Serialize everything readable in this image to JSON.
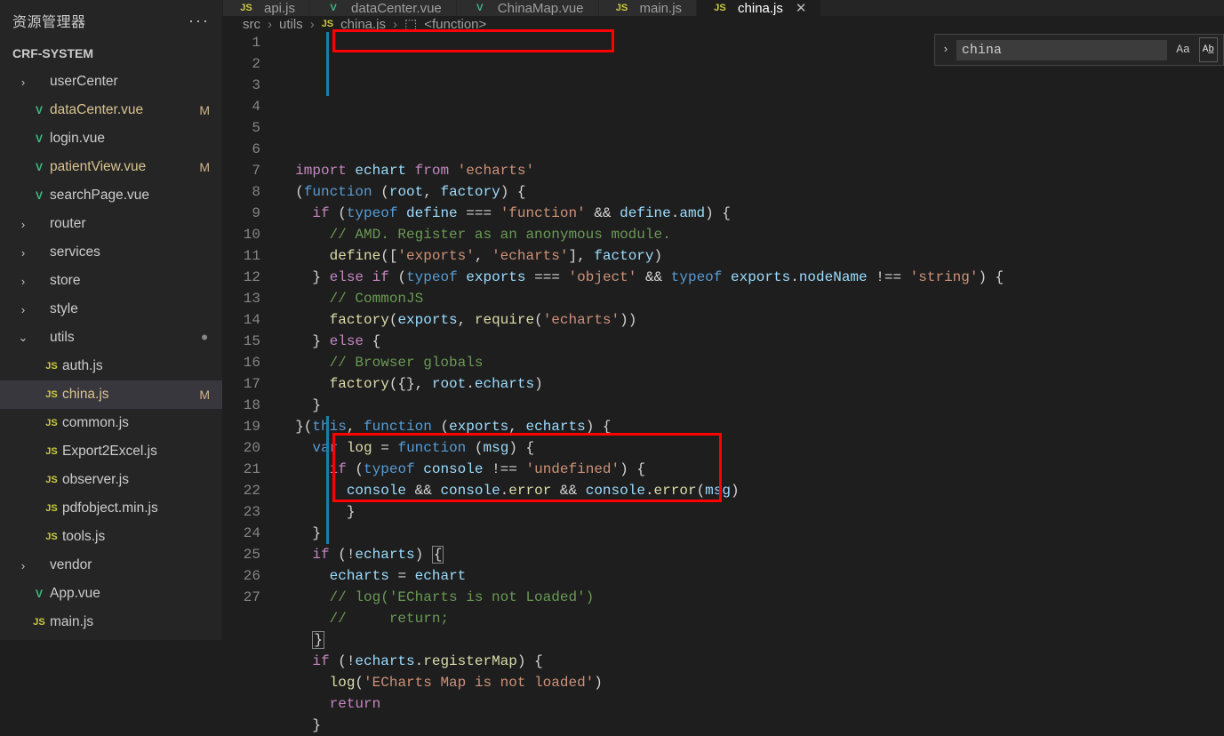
{
  "sidebar": {
    "title": "资源管理器",
    "project": "CRF-SYSTEM",
    "items": [
      {
        "chev": "›",
        "icon": "",
        "label": "userCenter",
        "badge": "",
        "kind": "folder"
      },
      {
        "chev": "",
        "icon": "V",
        "label": "dataCenter.vue",
        "badge": "M",
        "kind": "vue",
        "mod": true
      },
      {
        "chev": "",
        "icon": "V",
        "label": "login.vue",
        "badge": "",
        "kind": "vue"
      },
      {
        "chev": "",
        "icon": "V",
        "label": "patientView.vue",
        "badge": "M",
        "kind": "vue",
        "mod": true
      },
      {
        "chev": "",
        "icon": "V",
        "label": "searchPage.vue",
        "badge": "",
        "kind": "vue"
      },
      {
        "chev": "›",
        "icon": "",
        "label": "router",
        "badge": "",
        "kind": "folder"
      },
      {
        "chev": "›",
        "icon": "",
        "label": "services",
        "badge": "",
        "kind": "folder"
      },
      {
        "chev": "›",
        "icon": "",
        "label": "store",
        "badge": "",
        "kind": "folder"
      },
      {
        "chev": "›",
        "icon": "",
        "label": "style",
        "badge": "",
        "kind": "folder"
      },
      {
        "chev": "⌄",
        "icon": "",
        "label": "utils",
        "badge": "•",
        "kind": "folder-open"
      },
      {
        "chev": "",
        "icon": "JS",
        "label": "auth.js",
        "badge": "",
        "kind": "js",
        "nest": true
      },
      {
        "chev": "",
        "icon": "JS",
        "label": "china.js",
        "badge": "M",
        "kind": "js",
        "nest": true,
        "sel": true,
        "mod": true
      },
      {
        "chev": "",
        "icon": "JS",
        "label": "common.js",
        "badge": "",
        "kind": "js",
        "nest": true
      },
      {
        "chev": "",
        "icon": "JS",
        "label": "Export2Excel.js",
        "badge": "",
        "kind": "js",
        "nest": true
      },
      {
        "chev": "",
        "icon": "JS",
        "label": "observer.js",
        "badge": "",
        "kind": "js",
        "nest": true
      },
      {
        "chev": "",
        "icon": "JS",
        "label": "pdfobject.min.js",
        "badge": "",
        "kind": "js",
        "nest": true
      },
      {
        "chev": "",
        "icon": "JS",
        "label": "tools.js",
        "badge": "",
        "kind": "js",
        "nest": true
      },
      {
        "chev": "›",
        "icon": "",
        "label": "vendor",
        "badge": "",
        "kind": "folder"
      },
      {
        "chev": "",
        "icon": "V",
        "label": "App.vue",
        "badge": "",
        "kind": "vue"
      },
      {
        "chev": "",
        "icon": "JS",
        "label": "main.js",
        "badge": "",
        "kind": "js"
      }
    ]
  },
  "tabs": [
    {
      "icon": "JS",
      "kind": "js",
      "label": "api.js"
    },
    {
      "icon": "V",
      "kind": "vue",
      "label": "dataCenter.vue"
    },
    {
      "icon": "V",
      "kind": "vue",
      "label": "ChinaMap.vue"
    },
    {
      "icon": "JS",
      "kind": "js",
      "label": "main.js"
    },
    {
      "icon": "JS",
      "kind": "js",
      "label": "china.js",
      "active": true,
      "close": true
    }
  ],
  "breadcrumbs": [
    "src",
    "utils",
    "china.js",
    "<function>"
  ],
  "search": {
    "value": "china",
    "aa": "Aa",
    "ab": "Ab̲"
  },
  "code": {
    "start": 1,
    "lines": [
      "  <span class='c-pink'>import</span> <span class='c-lblue'>echart</span> <span class='c-pink'>from</span> <span class='c-str'>'echarts'</span>",
      "  <span class='c-punc'>(</span><span class='c-blue'>function</span> <span class='c-punc'>(</span><span class='c-lblue'>root</span><span class='c-punc'>,</span> <span class='c-lblue'>factory</span><span class='c-punc'>) {</span>",
      "    <span class='c-pink'>if</span> <span class='c-punc'>(</span><span class='c-blue'>typeof</span> <span class='c-lblue'>define</span> <span class='c-punc'>===</span> <span class='c-str'>'function'</span> <span class='c-punc'>&amp;&amp;</span> <span class='c-lblue'>define</span><span class='c-punc'>.</span><span class='c-lblue'>amd</span><span class='c-punc'>) {</span>",
      "      <span class='c-cmt'>// AMD. Register as an anonymous module.</span>",
      "      <span class='c-fn'>define</span><span class='c-punc'>([</span><span class='c-str'>'exports'</span><span class='c-punc'>,</span> <span class='c-str'>'echarts'</span><span class='c-punc'>],</span> <span class='c-lblue'>factory</span><span class='c-punc'>)</span>",
      "    <span class='c-punc'>}</span> <span class='c-pink'>else</span> <span class='c-pink'>if</span> <span class='c-punc'>(</span><span class='c-blue'>typeof</span> <span class='c-lblue'>exports</span> <span class='c-punc'>===</span> <span class='c-str'>'object'</span> <span class='c-punc'>&amp;&amp;</span> <span class='c-blue'>typeof</span> <span class='c-lblue'>exports</span><span class='c-punc'>.</span><span class='c-lblue'>nodeName</span> <span class='c-punc'>!==</span> <span class='c-str'>'string'</span><span class='c-punc'>) {</span>",
      "      <span class='c-cmt'>// CommonJS</span>",
      "      <span class='c-fn'>factory</span><span class='c-punc'>(</span><span class='c-lblue'>exports</span><span class='c-punc'>,</span> <span class='c-fn'>require</span><span class='c-punc'>(</span><span class='c-str'>'echarts'</span><span class='c-punc'>))</span>",
      "    <span class='c-punc'>}</span> <span class='c-pink'>else</span> <span class='c-punc'>{</span>",
      "      <span class='c-cmt'>// Browser globals</span>",
      "      <span class='c-fn'>factory</span><span class='c-punc'>({},</span> <span class='c-lblue'>root</span><span class='c-punc'>.</span><span class='c-lblue'>echarts</span><span class='c-punc'>)</span>",
      "    <span class='c-punc'>}</span>",
      "  <span class='c-punc'>}(</span><span class='c-blue'>this</span><span class='c-punc'>,</span> <span class='c-blue'>function</span> <span class='c-punc'>(</span><span class='c-lblue'>exports</span><span class='c-punc'>,</span> <span class='c-lblue'>echarts</span><span class='c-punc'>) {</span>",
      "    <span class='c-blue'>var</span> <span class='c-fn'>log</span> <span class='c-punc'>=</span> <span class='c-blue'>function</span> <span class='c-punc'>(</span><span class='c-lblue'>msg</span><span class='c-punc'>) {</span>",
      "      <span class='c-pink'>if</span> <span class='c-punc'>(</span><span class='c-blue'>typeof</span> <span class='c-lblue'>console</span> <span class='c-punc'>!==</span> <span class='c-str'>'undefined'</span><span class='c-punc'>) {</span>",
      "        <span class='c-lblue'>console</span> <span class='c-punc'>&amp;&amp;</span> <span class='c-lblue'>console</span><span class='c-punc'>.</span><span class='c-fn'>error</span> <span class='c-punc'>&amp;&amp;</span> <span class='c-lblue'>console</span><span class='c-punc'>.</span><span class='c-fn'>error</span><span class='c-punc'>(</span><span class='c-lblue'>msg</span><span class='c-punc'>)</span>",
      "        <span class='c-punc'>}</span>",
      "    <span class='c-punc'>}</span>",
      "    <span class='c-pink'>if</span> <span class='c-punc'>(!</span><span class='c-lblue'>echarts</span><span class='c-punc'>) <span style=\"border:1px solid #858585;padding:0 1px\">{</span></span>",
      "      <span class='c-lblue'>echarts</span> <span class='c-punc'>=</span> <span class='c-lblue'>echart</span>",
      "      <span class='c-cmt'>// log('ECharts is not Loaded')</span>",
      "      <span class='c-cmt'>//     return;</span>",
      "    <span class='c-punc'><span style=\"border:1px solid #858585;padding:0 1px\">}</span></span>",
      "    <span class='c-pink'>if</span> <span class='c-punc'>(!</span><span class='c-lblue'>echarts</span><span class='c-punc'>.</span><span class='c-fn'>registerMap</span><span class='c-punc'>) {</span>",
      "      <span class='c-fn'>log</span><span class='c-punc'>(</span><span class='c-str'>'ECharts Map is not loaded'</span><span class='c-punc'>)</span>",
      "      <span class='c-pink'>return</span>",
      "    <span class='c-punc'>}</span>"
    ]
  }
}
